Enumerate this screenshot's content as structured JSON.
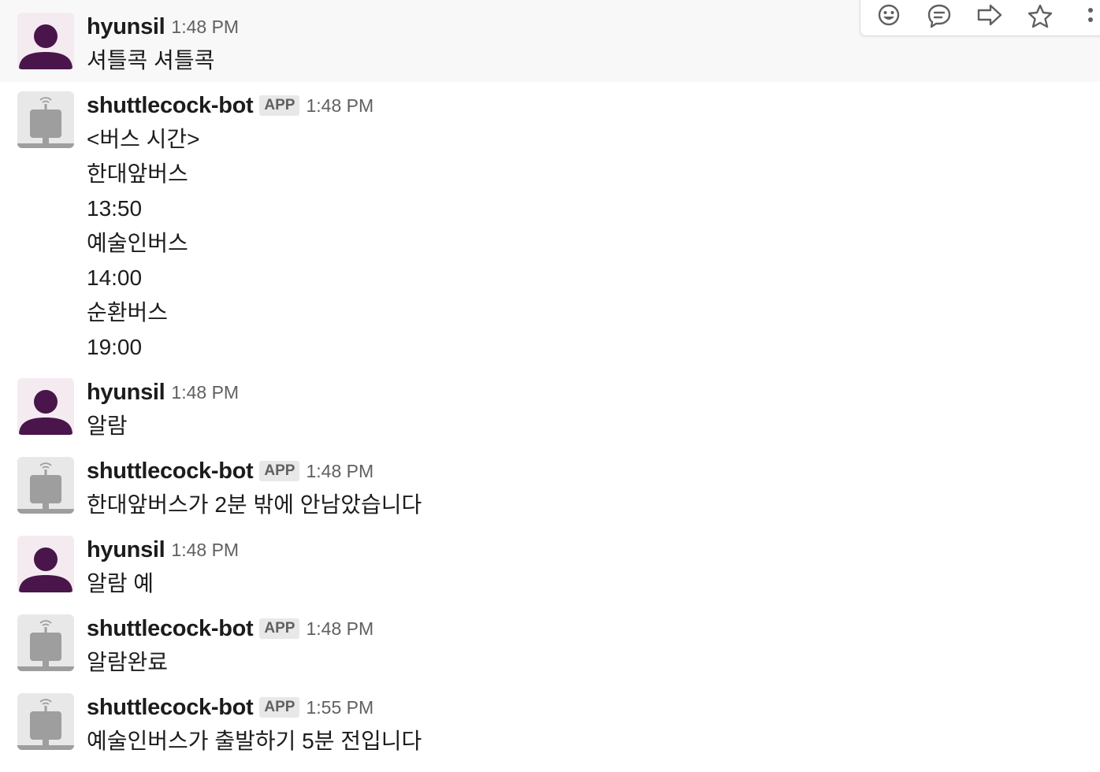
{
  "messages": [
    {
      "author": "hyunsil",
      "is_app": false,
      "timestamp": "1:48 PM",
      "lines": [
        "셔틀콕 셔틀콕"
      ]
    },
    {
      "author": "shuttlecock-bot",
      "is_app": true,
      "app_badge": "APP",
      "timestamp": "1:48 PM",
      "lines": [
        "<버스 시간>",
        "한대앞버스",
        "13:50",
        "예술인버스",
        "14:00",
        "순환버스",
        "19:00"
      ]
    },
    {
      "author": "hyunsil",
      "is_app": false,
      "timestamp": "1:48 PM",
      "lines": [
        "알람"
      ]
    },
    {
      "author": "shuttlecock-bot",
      "is_app": true,
      "app_badge": "APP",
      "timestamp": "1:48 PM",
      "lines": [
        "한대앞버스가 2분 밖에 안남았습니다"
      ]
    },
    {
      "author": "hyunsil",
      "is_app": false,
      "timestamp": "1:48 PM",
      "lines": [
        "알람 예"
      ]
    },
    {
      "author": "shuttlecock-bot",
      "is_app": true,
      "app_badge": "APP",
      "timestamp": "1:48 PM",
      "lines": [
        "알람완료"
      ]
    },
    {
      "author": "shuttlecock-bot",
      "is_app": true,
      "app_badge": "APP",
      "timestamp": "1:55 PM",
      "lines": [
        "예술인버스가 출발하기 5분 전입니다"
      ]
    }
  ],
  "message_actions": [
    {
      "icon": "add-reaction-icon"
    },
    {
      "icon": "thread-reply-icon"
    },
    {
      "icon": "share-message-icon"
    },
    {
      "icon": "star-icon"
    },
    {
      "icon": "more-actions-icon"
    }
  ],
  "colors": {
    "user_avatar_bg": "#f4ebf1",
    "user_avatar_fg": "#4a154b",
    "bot_avatar_bg": "#e8e8e8",
    "bot_avatar_fg": "#9e9e9e",
    "hover_bg": "#f8f8f8",
    "action_icon": "#616061"
  }
}
